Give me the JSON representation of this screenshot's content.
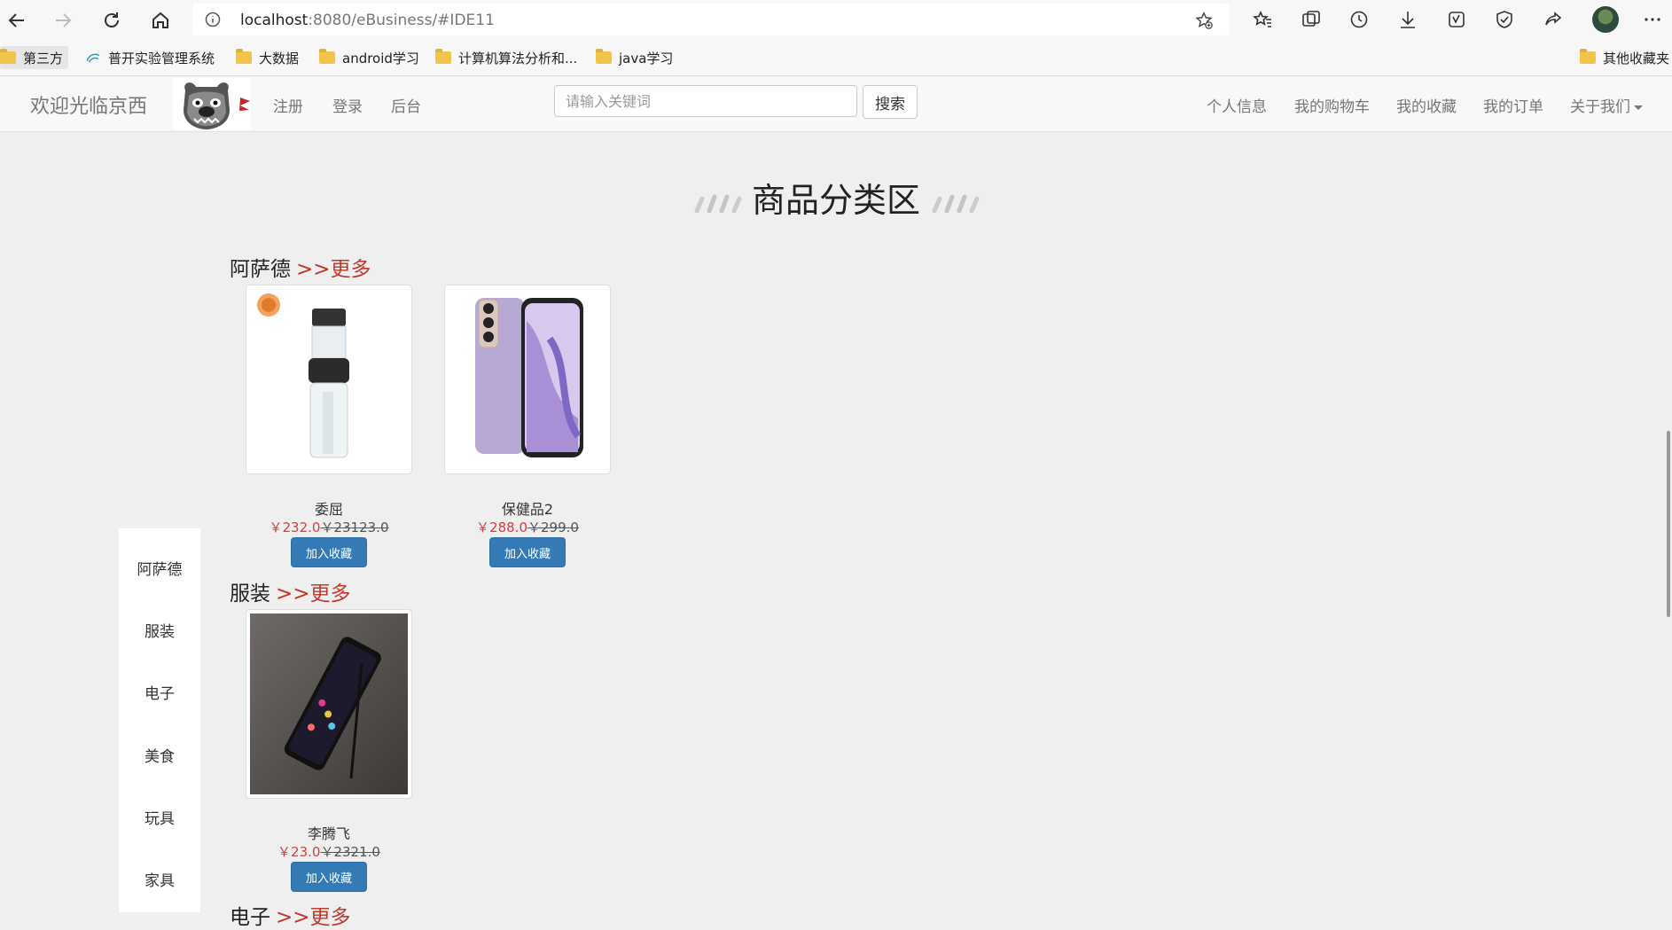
{
  "browser": {
    "url_host": "localhost",
    "url_rest": ":8080/eBusiness/#IDE11",
    "bookmarks": [
      "第三方",
      "普开实验管理系统",
      "大数据",
      "android学习",
      "计算机算法分析和...",
      "java学习",
      "其他收藏夹"
    ]
  },
  "navbar": {
    "brand": "欢迎光临京西",
    "links": [
      "注册",
      "登录",
      "后台"
    ],
    "search_placeholder": "请输入关键词",
    "search_button": "搜索",
    "right_links": [
      "个人信息",
      "我的购物车",
      "我的收藏",
      "我的订单",
      "关于我们"
    ]
  },
  "main": {
    "heading": "商品分类区",
    "more_label": ">>更多",
    "categories": [
      {
        "name": "阿萨德",
        "products": [
          {
            "name": "委屈",
            "price": "￥232.0",
            "old_price": "￥23123.0",
            "button": "加入收藏"
          },
          {
            "name": "保健品2",
            "price": "￥288.0",
            "old_price": "￥299.0",
            "button": "加入收藏"
          }
        ]
      },
      {
        "name": "服装",
        "products": [
          {
            "name": "李腾飞",
            "price": "￥23.0",
            "old_price": "￥2321.0",
            "button": "加入收藏"
          }
        ]
      },
      {
        "name": "电子",
        "products": []
      }
    ]
  },
  "side_menu": [
    "阿萨德",
    "服装",
    "电子",
    "美食",
    "玩具",
    "家具"
  ]
}
